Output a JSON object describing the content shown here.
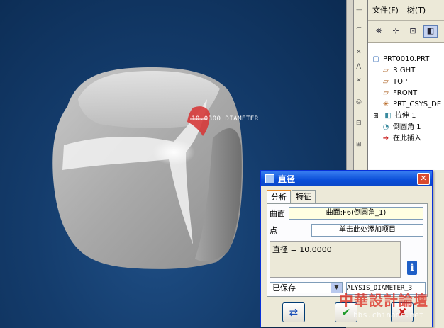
{
  "viewport": {
    "dimension_label": "10.0300 DIAMETER"
  },
  "tree_panel": {
    "menu": [
      "文件(F)",
      "树(T)"
    ],
    "items": [
      {
        "label": "PRT0010.PRT",
        "icon": "part-icon"
      },
      {
        "label": "RIGHT",
        "icon": "datum-plane-icon"
      },
      {
        "label": "TOP",
        "icon": "datum-plane-icon"
      },
      {
        "label": "FRONT",
        "icon": "datum-plane-icon"
      },
      {
        "label": "PRT_CSYS_DE",
        "icon": "csys-icon"
      },
      {
        "label": "拉伸 1",
        "icon": "extrude-icon"
      },
      {
        "label": "倒圆角 1",
        "icon": "round-icon"
      },
      {
        "label": "在此插入",
        "icon": "insert-arrow-icon"
      }
    ]
  },
  "dialog": {
    "title": "直径",
    "tabs": [
      "分析",
      "特征"
    ],
    "surface_label": "曲面",
    "surface_value": "曲面:F6(倒圆角_1)",
    "point_label": "点",
    "point_value": "单击此处添加项目",
    "result": "直径 = 10.0000",
    "saved_option": "已保存",
    "name_value": "ALYSIS_DIAMETER_3"
  },
  "watermark": {
    "text": "中華設計論壇",
    "url": "bbs.chinade.net"
  },
  "colors": {
    "viewport_bg": "#143c6c",
    "dialog_title": "#0a4ed8",
    "highlight_red": "#d63a3a"
  }
}
